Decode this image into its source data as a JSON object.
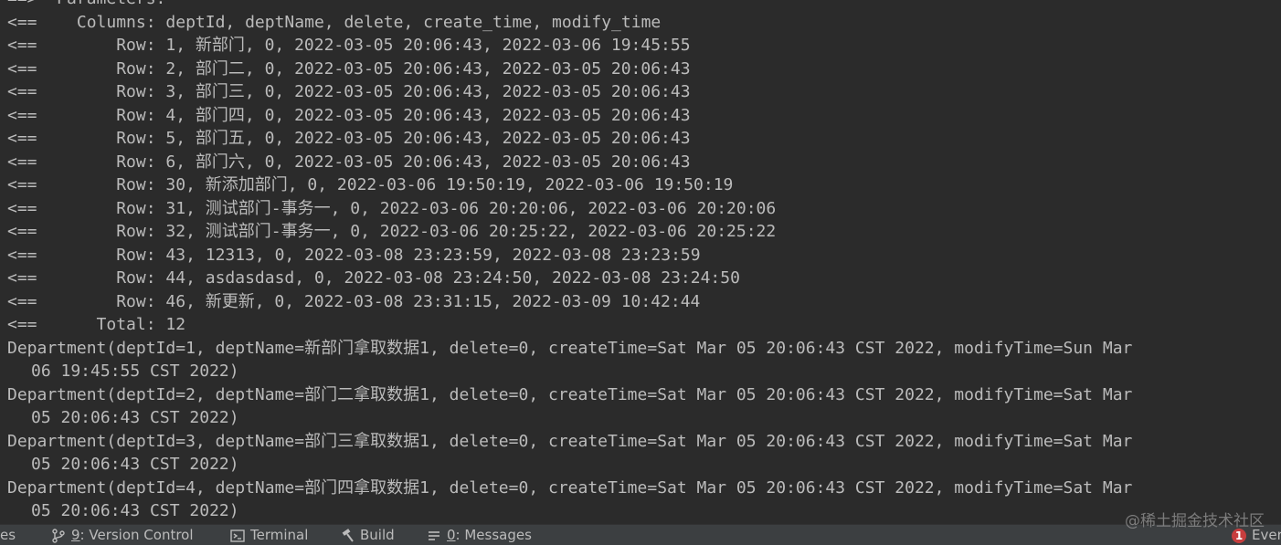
{
  "console": {
    "lines": [
      {
        "text": "==>  Parameters:",
        "indent": false
      },
      {
        "text": "<==    Columns: deptId, deptName, delete, create_time, modify_time",
        "indent": false
      },
      {
        "text": "<==        Row: 1, 新部门, 0, 2022-03-05 20:06:43, 2022-03-06 19:45:55",
        "indent": false
      },
      {
        "text": "<==        Row: 2, 部门二, 0, 2022-03-05 20:06:43, 2022-03-05 20:06:43",
        "indent": false
      },
      {
        "text": "<==        Row: 3, 部门三, 0, 2022-03-05 20:06:43, 2022-03-05 20:06:43",
        "indent": false
      },
      {
        "text": "<==        Row: 4, 部门四, 0, 2022-03-05 20:06:43, 2022-03-05 20:06:43",
        "indent": false
      },
      {
        "text": "<==        Row: 5, 部门五, 0, 2022-03-05 20:06:43, 2022-03-05 20:06:43",
        "indent": false
      },
      {
        "text": "<==        Row: 6, 部门六, 0, 2022-03-05 20:06:43, 2022-03-05 20:06:43",
        "indent": false
      },
      {
        "text": "<==        Row: 30, 新添加部门, 0, 2022-03-06 19:50:19, 2022-03-06 19:50:19",
        "indent": false
      },
      {
        "text": "<==        Row: 31, 测试部门-事务一, 0, 2022-03-06 20:20:06, 2022-03-06 20:20:06",
        "indent": false
      },
      {
        "text": "<==        Row: 32, 测试部门-事务一, 0, 2022-03-06 20:25:22, 2022-03-06 20:25:22",
        "indent": false
      },
      {
        "text": "<==        Row: 43, 12313, 0, 2022-03-08 23:23:59, 2022-03-08 23:23:59",
        "indent": false
      },
      {
        "text": "<==        Row: 44, asdasdasd, 0, 2022-03-08 23:24:50, 2022-03-08 23:24:50",
        "indent": false
      },
      {
        "text": "<==        Row: 46, 新更新, 0, 2022-03-08 23:31:15, 2022-03-09 10:42:44",
        "indent": false
      },
      {
        "text": "<==      Total: 12",
        "indent": false
      },
      {
        "text": "Department(deptId=1, deptName=新部门拿取数据1, delete=0, createTime=Sat Mar 05 20:06:43 CST 2022, modifyTime=Sun Mar",
        "indent": false
      },
      {
        "text": "06 19:45:55 CST 2022)",
        "indent": true
      },
      {
        "text": "Department(deptId=2, deptName=部门二拿取数据1, delete=0, createTime=Sat Mar 05 20:06:43 CST 2022, modifyTime=Sat Mar",
        "indent": false
      },
      {
        "text": "05 20:06:43 CST 2022)",
        "indent": true
      },
      {
        "text": "Department(deptId=3, deptName=部门三拿取数据1, delete=0, createTime=Sat Mar 05 20:06:43 CST 2022, modifyTime=Sat Mar",
        "indent": false
      },
      {
        "text": "05 20:06:43 CST 2022)",
        "indent": true
      },
      {
        "text": "Department(deptId=4, deptName=部门四拿取数据1, delete=0, createTime=Sat Mar 05 20:06:43 CST 2022, modifyTime=Sat Mar",
        "indent": false
      },
      {
        "text": "05 20:06:43 CST 2022)",
        "indent": true
      }
    ]
  },
  "status_bar": {
    "left_partial": "es",
    "version_control": {
      "key": "9",
      "label": ": Version Control"
    },
    "terminal": {
      "label": "Terminal"
    },
    "build": {
      "label": "Build"
    },
    "messages": {
      "key": "0",
      "label": ": Messages"
    },
    "event_log": {
      "count": "1",
      "label": "Ever"
    }
  },
  "watermark": "@稀土掘金技术社区",
  "icons": {
    "version_control": "branch-icon",
    "terminal": "terminal-icon",
    "build": "hammer-icon",
    "messages": "messages-icon",
    "event_log": "event-badge-icon"
  },
  "colors": {
    "console_bg": "#2b2b2b",
    "console_text": "#bbbbbb",
    "status_bg": "#3c3f41",
    "badge": "#c73e3e"
  }
}
